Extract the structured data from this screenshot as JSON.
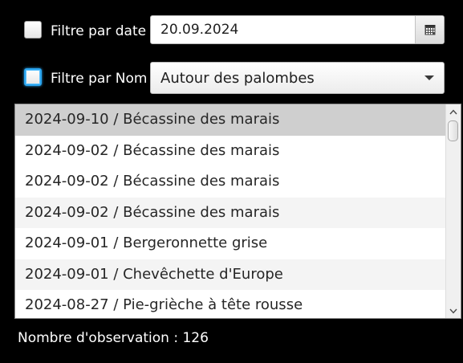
{
  "filters": {
    "date": {
      "checkbox_checked": false,
      "label": "Filtre par date",
      "value": "20.09.2024",
      "button_icon": "calendar-icon"
    },
    "name": {
      "checkbox_checked": false,
      "label": "Filtre par Nom",
      "selected_value": "Autour des palombes",
      "arrow_icon": "chevron-down-icon"
    }
  },
  "list": {
    "items": [
      {
        "label": "2024-09-10 / Bécassine des marais",
        "selected": true
      },
      {
        "label": "2024-09-02 / Bécassine des marais",
        "selected": false
      },
      {
        "label": "2024-09-02 / Bécassine des marais",
        "selected": false
      },
      {
        "label": "2024-09-02 / Bécassine des marais",
        "selected": false
      },
      {
        "label": "2024-09-01 / Bergeronnette grise",
        "selected": false
      },
      {
        "label": "2024-09-01 / Chevêchette d'Europe",
        "selected": false
      },
      {
        "label": "2024-08-27 / Pie-grièche à tête rousse",
        "selected": false
      }
    ],
    "scrollbar": {
      "up_icon": "chevron-up-icon",
      "down_icon": "chevron-down-icon"
    }
  },
  "status": {
    "observation_count_text": "Nombre d'observation : 126"
  },
  "colors": {
    "background": "#000000",
    "selected_row": "#cfcfcf",
    "alternate_row": "#f4f4f4",
    "focus_ring": "#2aa4ee"
  }
}
